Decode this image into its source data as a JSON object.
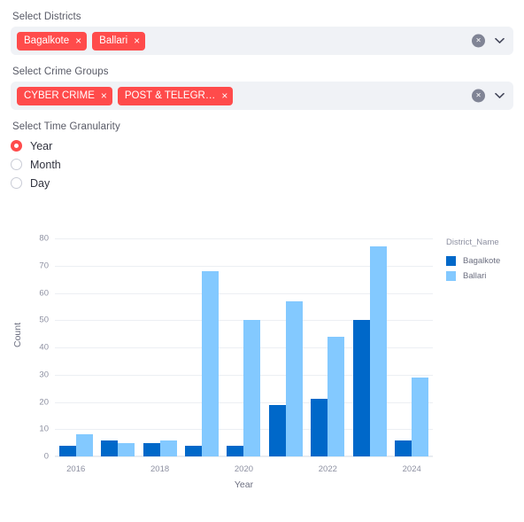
{
  "districts_filter": {
    "label": "Select Districts",
    "tags": [
      {
        "text": "Bagalkote",
        "remove": "×"
      },
      {
        "text": "Ballari",
        "remove": "×"
      }
    ],
    "clear_icon": "×",
    "chevron_icon": "⌄"
  },
  "crime_groups_filter": {
    "label": "Select Crime Groups",
    "tags": [
      {
        "text": "CYBER CRIME",
        "remove": "×"
      },
      {
        "text": "POST & TELEGR…",
        "remove": "×"
      }
    ],
    "clear_icon": "×",
    "chevron_icon": "⌄"
  },
  "time_granularity": {
    "label": "Select Time Granularity",
    "options": [
      {
        "label": "Year",
        "selected": true
      },
      {
        "label": "Month",
        "selected": false
      },
      {
        "label": "Day",
        "selected": false
      }
    ]
  },
  "theme": {
    "accent": "#ff4b4b",
    "widget_bg": "#f0f2f6",
    "series_0": "#0068c9",
    "series_1": "#83c9ff"
  },
  "chart_data": {
    "type": "bar",
    "title": "",
    "xlabel": "Year",
    "ylabel": "Count",
    "categories": [
      "2016",
      "2017",
      "2018",
      "2019",
      "2020",
      "2021",
      "2022",
      "2023",
      "2024"
    ],
    "visible_xticks": [
      "2016",
      "2018",
      "2020",
      "2022",
      "2024"
    ],
    "yticks": [
      0,
      10,
      20,
      30,
      40,
      50,
      60,
      70,
      80
    ],
    "ylim": [
      0,
      80
    ],
    "grid": true,
    "legend_title": "District_Name",
    "legend_position": "right",
    "series": [
      {
        "name": "Bagalkote",
        "color": "#0068c9",
        "values": [
          4,
          6,
          5,
          4,
          4,
          19,
          21,
          50,
          6
        ]
      },
      {
        "name": "Ballari",
        "color": "#83c9ff",
        "values": [
          8,
          5,
          6,
          68,
          50,
          57,
          44,
          77,
          29
        ]
      }
    ]
  }
}
